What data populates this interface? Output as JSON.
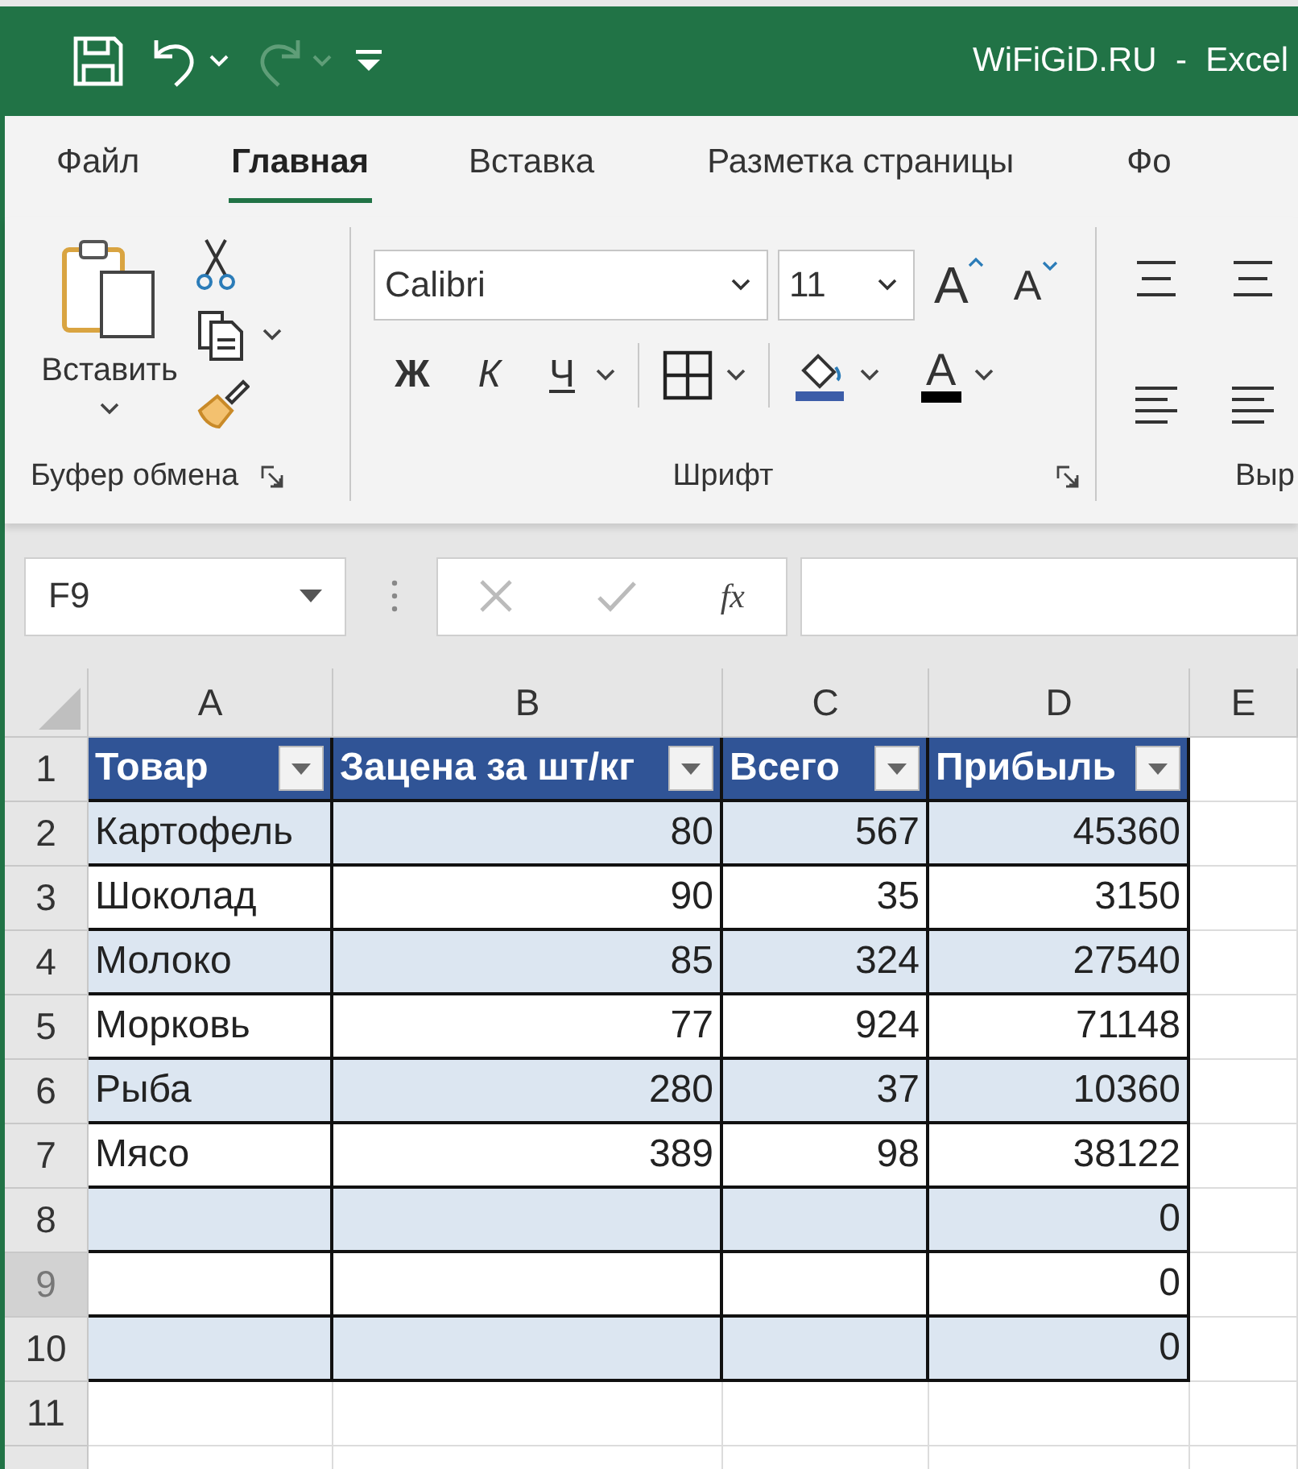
{
  "window": {
    "title": "WiFiGiD.RU  -  Excel"
  },
  "quick_access": [
    {
      "kind": "save",
      "disabled": false
    },
    {
      "kind": "undo",
      "disabled": false
    },
    {
      "kind": "redo",
      "disabled": true
    },
    {
      "kind": "customize",
      "disabled": false
    }
  ],
  "tabs": [
    {
      "label": "Файл",
      "selected": false
    },
    {
      "label": "Главная",
      "selected": true
    },
    {
      "label": "Вставка",
      "selected": false
    },
    {
      "label": "Разметка страницы",
      "selected": false
    },
    {
      "label": "Фо",
      "selected": false
    }
  ],
  "ribbon": {
    "groups": [
      {
        "kind": "clipboard",
        "label": "Буфер обмена",
        "paste_label": "Вставить"
      },
      {
        "kind": "font",
        "label": "Шрифт",
        "font_name": "Calibri",
        "font_size": "11",
        "grow_label": "A",
        "shrink_label": "A",
        "bold_label": "Ж",
        "italic_label": "К",
        "underline_label": "Ч",
        "font_color_label": "A"
      },
      {
        "kind": "alignment",
        "label": "Выр"
      }
    ]
  },
  "formula_bar": {
    "name_box": "F9",
    "fx_label": "fx"
  },
  "sheet": {
    "columns": [
      {
        "label": "A",
        "selected": false
      },
      {
        "label": "B",
        "selected": false
      },
      {
        "label": "C",
        "selected": false
      },
      {
        "label": "D",
        "selected": false
      },
      {
        "label": "E",
        "selected": false
      }
    ],
    "row_headers": [
      {
        "label": "1",
        "selected": false
      },
      {
        "label": "2",
        "selected": false
      },
      {
        "label": "3",
        "selected": false
      },
      {
        "label": "4",
        "selected": false
      },
      {
        "label": "5",
        "selected": false
      },
      {
        "label": "6",
        "selected": false
      },
      {
        "label": "7",
        "selected": false
      },
      {
        "label": "8",
        "selected": false
      },
      {
        "label": "9",
        "selected": true
      },
      {
        "label": "10",
        "selected": false
      },
      {
        "label": "11",
        "selected": false
      }
    ],
    "table": {
      "banded_rows": true,
      "headers": [
        "Товар",
        "Зацена за шт/кг",
        "Всего",
        "Прибыль"
      ],
      "rows": [
        [
          "Картофель",
          "80",
          "567",
          "45360"
        ],
        [
          "Шоколад",
          "90",
          "35",
          "3150"
        ],
        [
          "Молоко",
          "85",
          "324",
          "27540"
        ],
        [
          "Морковь",
          "77",
          "924",
          "71148"
        ],
        [
          "Рыба",
          "280",
          "37",
          "10360"
        ],
        [
          "Мясо",
          "389",
          "98",
          "38122"
        ],
        [
          null,
          null,
          null,
          "0"
        ],
        [
          null,
          null,
          null,
          "0"
        ],
        [
          null,
          null,
          null,
          "0"
        ]
      ]
    }
  }
}
